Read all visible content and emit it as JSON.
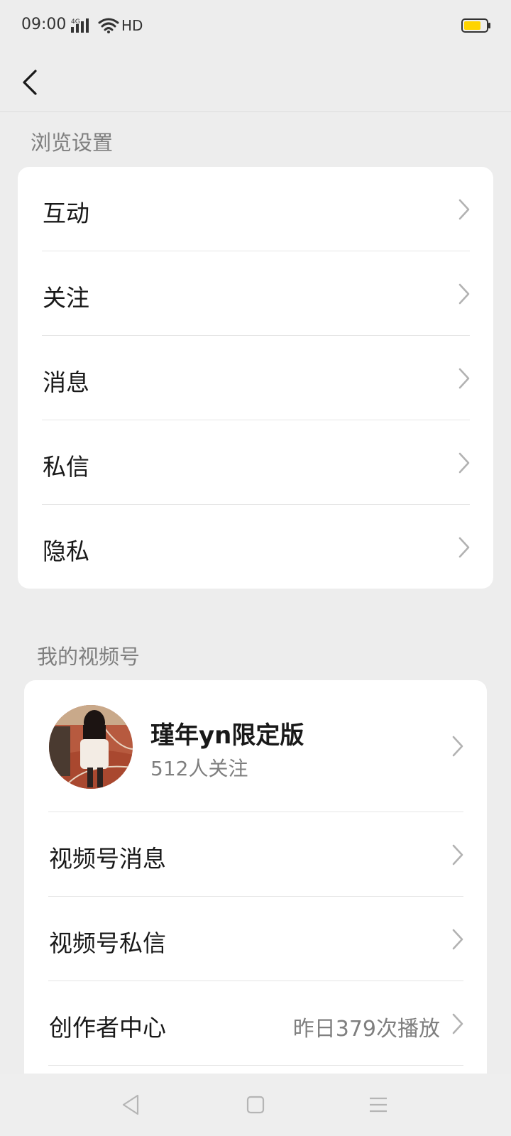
{
  "status_bar": {
    "time": "09:00",
    "network": "4G",
    "hd": "HD",
    "battery_level": 0.75,
    "battery_color": "#ffd400"
  },
  "header": {
    "back_icon": "chevron-left-icon"
  },
  "browse_settings": {
    "title": "浏览设置",
    "items": [
      {
        "label": "互动"
      },
      {
        "label": "关注"
      },
      {
        "label": "消息"
      },
      {
        "label": "私信"
      },
      {
        "label": "隐私"
      }
    ]
  },
  "my_channel": {
    "title": "我的视频号",
    "profile": {
      "name": "瑾年yn限定版",
      "followers": "512人关注"
    },
    "items": [
      {
        "label": "视频号消息",
        "value": ""
      },
      {
        "label": "视频号私信",
        "value": ""
      },
      {
        "label": "创作者中心",
        "value": "昨日379次播放"
      }
    ]
  },
  "nav_bar": {
    "icons": [
      "back-triangle-icon",
      "home-square-icon",
      "menu-lines-icon"
    ]
  },
  "colors": {
    "background": "#ededed",
    "card": "#ffffff",
    "text_primary": "#191919",
    "text_secondary": "#7f7f7f",
    "divider": "#e5e5e5"
  }
}
